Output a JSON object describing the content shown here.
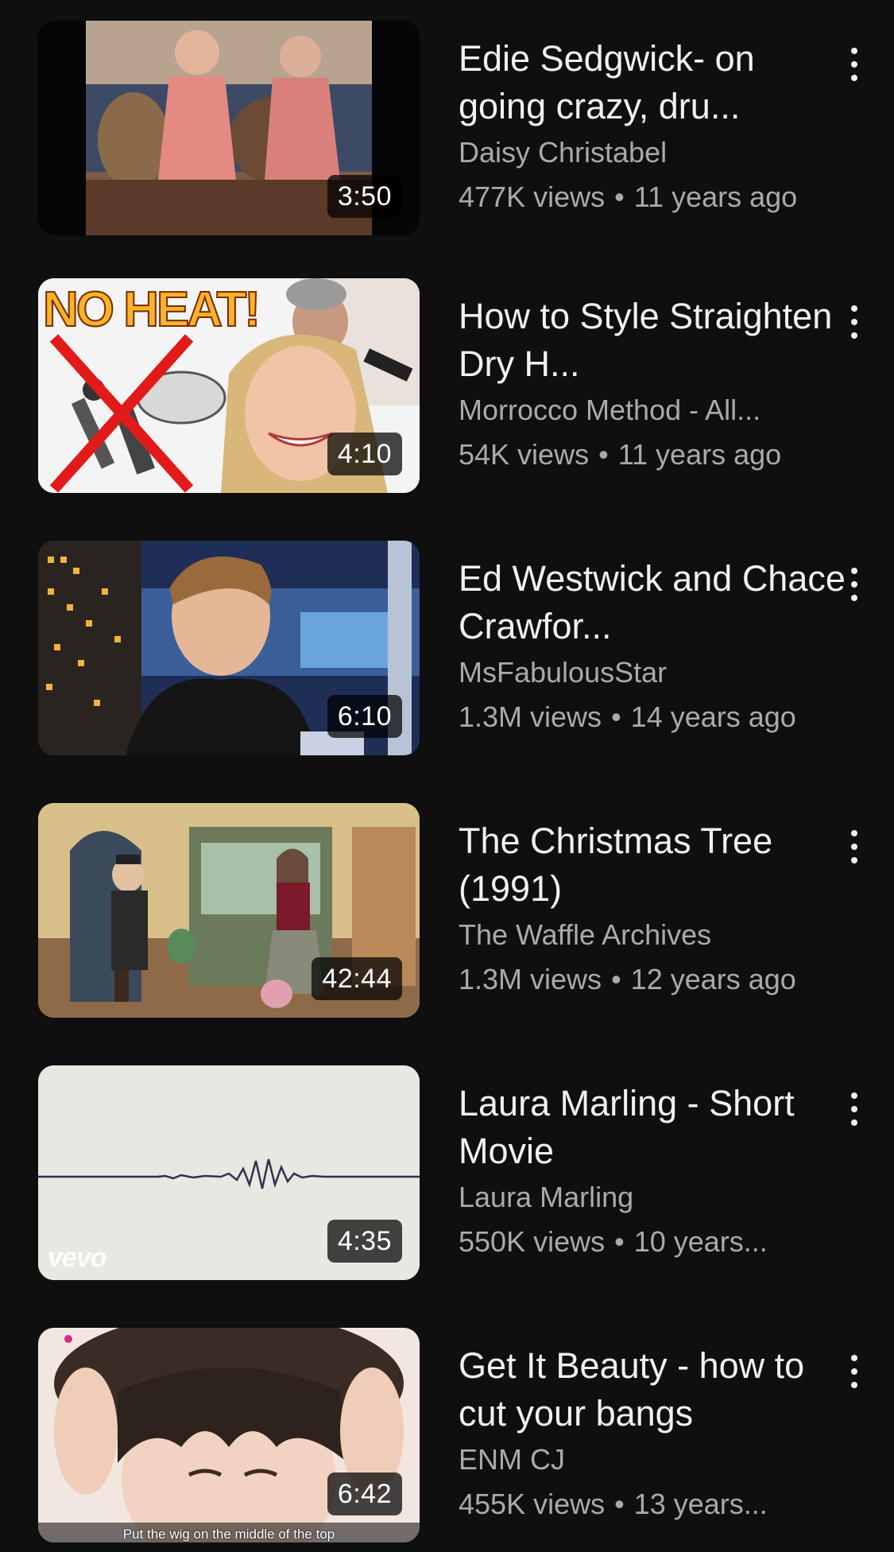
{
  "videos": [
    {
      "title": "Edie Sedgwick- on going crazy, dru...",
      "channel": "Daisy Christabel",
      "views": "477K views",
      "age": "11 years ago",
      "duration": "3:50",
      "thumbnail_icon": "film-still-two-women-sofa"
    },
    {
      "title": "How to Style Straighten Dry H...",
      "channel": "Morrocco Method - All...",
      "views": "54K views",
      "age": "11 years ago",
      "duration": "4:10",
      "thumbnail_icon": "no-heat-hair-thumbnail",
      "thumbnail_text": "NO HEAT!"
    },
    {
      "title": "Ed Westwick and Chace Crawfor...",
      "channel": "MsFabulousStar",
      "views": "1.3M views",
      "age": "14 years ago",
      "duration": "6:10",
      "thumbnail_icon": "tv-interview-still"
    },
    {
      "title": "The Christmas Tree (1991)",
      "channel": "The Waffle Archives",
      "views": "1.3M views",
      "age": "12 years ago",
      "duration": "42:44",
      "thumbnail_icon": "cartoon-room-scene"
    },
    {
      "title": "Laura Marling - Short Movie",
      "channel": "Laura Marling",
      "views": "550K views",
      "age": "10 years...",
      "duration": "4:35",
      "thumbnail_icon": "waveform-thumbnail",
      "thumbnail_text": "vevo"
    },
    {
      "title": "Get It Beauty - how to cut your bangs",
      "channel": "ENM CJ",
      "views": "455K views",
      "age": "13 years...",
      "duration": "6:42",
      "thumbnail_icon": "hair-bangs-closeup",
      "thumbnail_text": "Put the wig on the middle of the top"
    }
  ],
  "separator": "•",
  "colors": {
    "background": "#0f0f0f",
    "title": "#f1f1f1",
    "secondary": "#aaaaaa"
  }
}
